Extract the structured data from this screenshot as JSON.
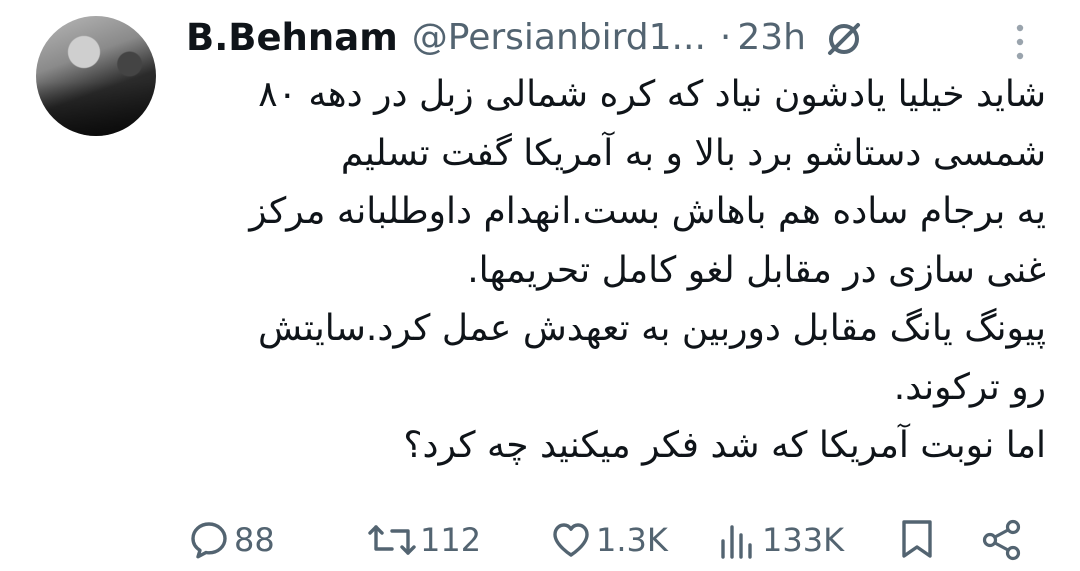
{
  "author": {
    "display_name": "B.Behnam",
    "handle": "@Persianbird1...",
    "separator": "·",
    "time": "23h"
  },
  "icons": {
    "no_symbol": "no-entry-icon",
    "more": "more-vertical-icon"
  },
  "tweet": {
    "lines": [
      "شاید خیلیا یادشون نیاد که کره شمالی زبل در دهه ۸۰",
      "شمسی دستاشو برد بالا و به آمریکا گفت تسلیم",
      "یه برجام ساده هم باهاش بست.انهدام داوطلبانه مرکز",
      "غنی سازی در مقابل لغو کامل تحریمها.",
      "پیونگ یانگ مقابل دوربین به تعهدش عمل کرد.سایتش",
      "رو ترکوند.",
      "اما نوبت آمریکا که شد فکر میکنید چه کرد؟"
    ]
  },
  "actions": {
    "replies": "88",
    "retweets": "112",
    "likes": "1.3K",
    "views": "133K"
  },
  "colors": {
    "text": "#0f1419",
    "secondary": "#536471",
    "background": "#ffffff"
  }
}
